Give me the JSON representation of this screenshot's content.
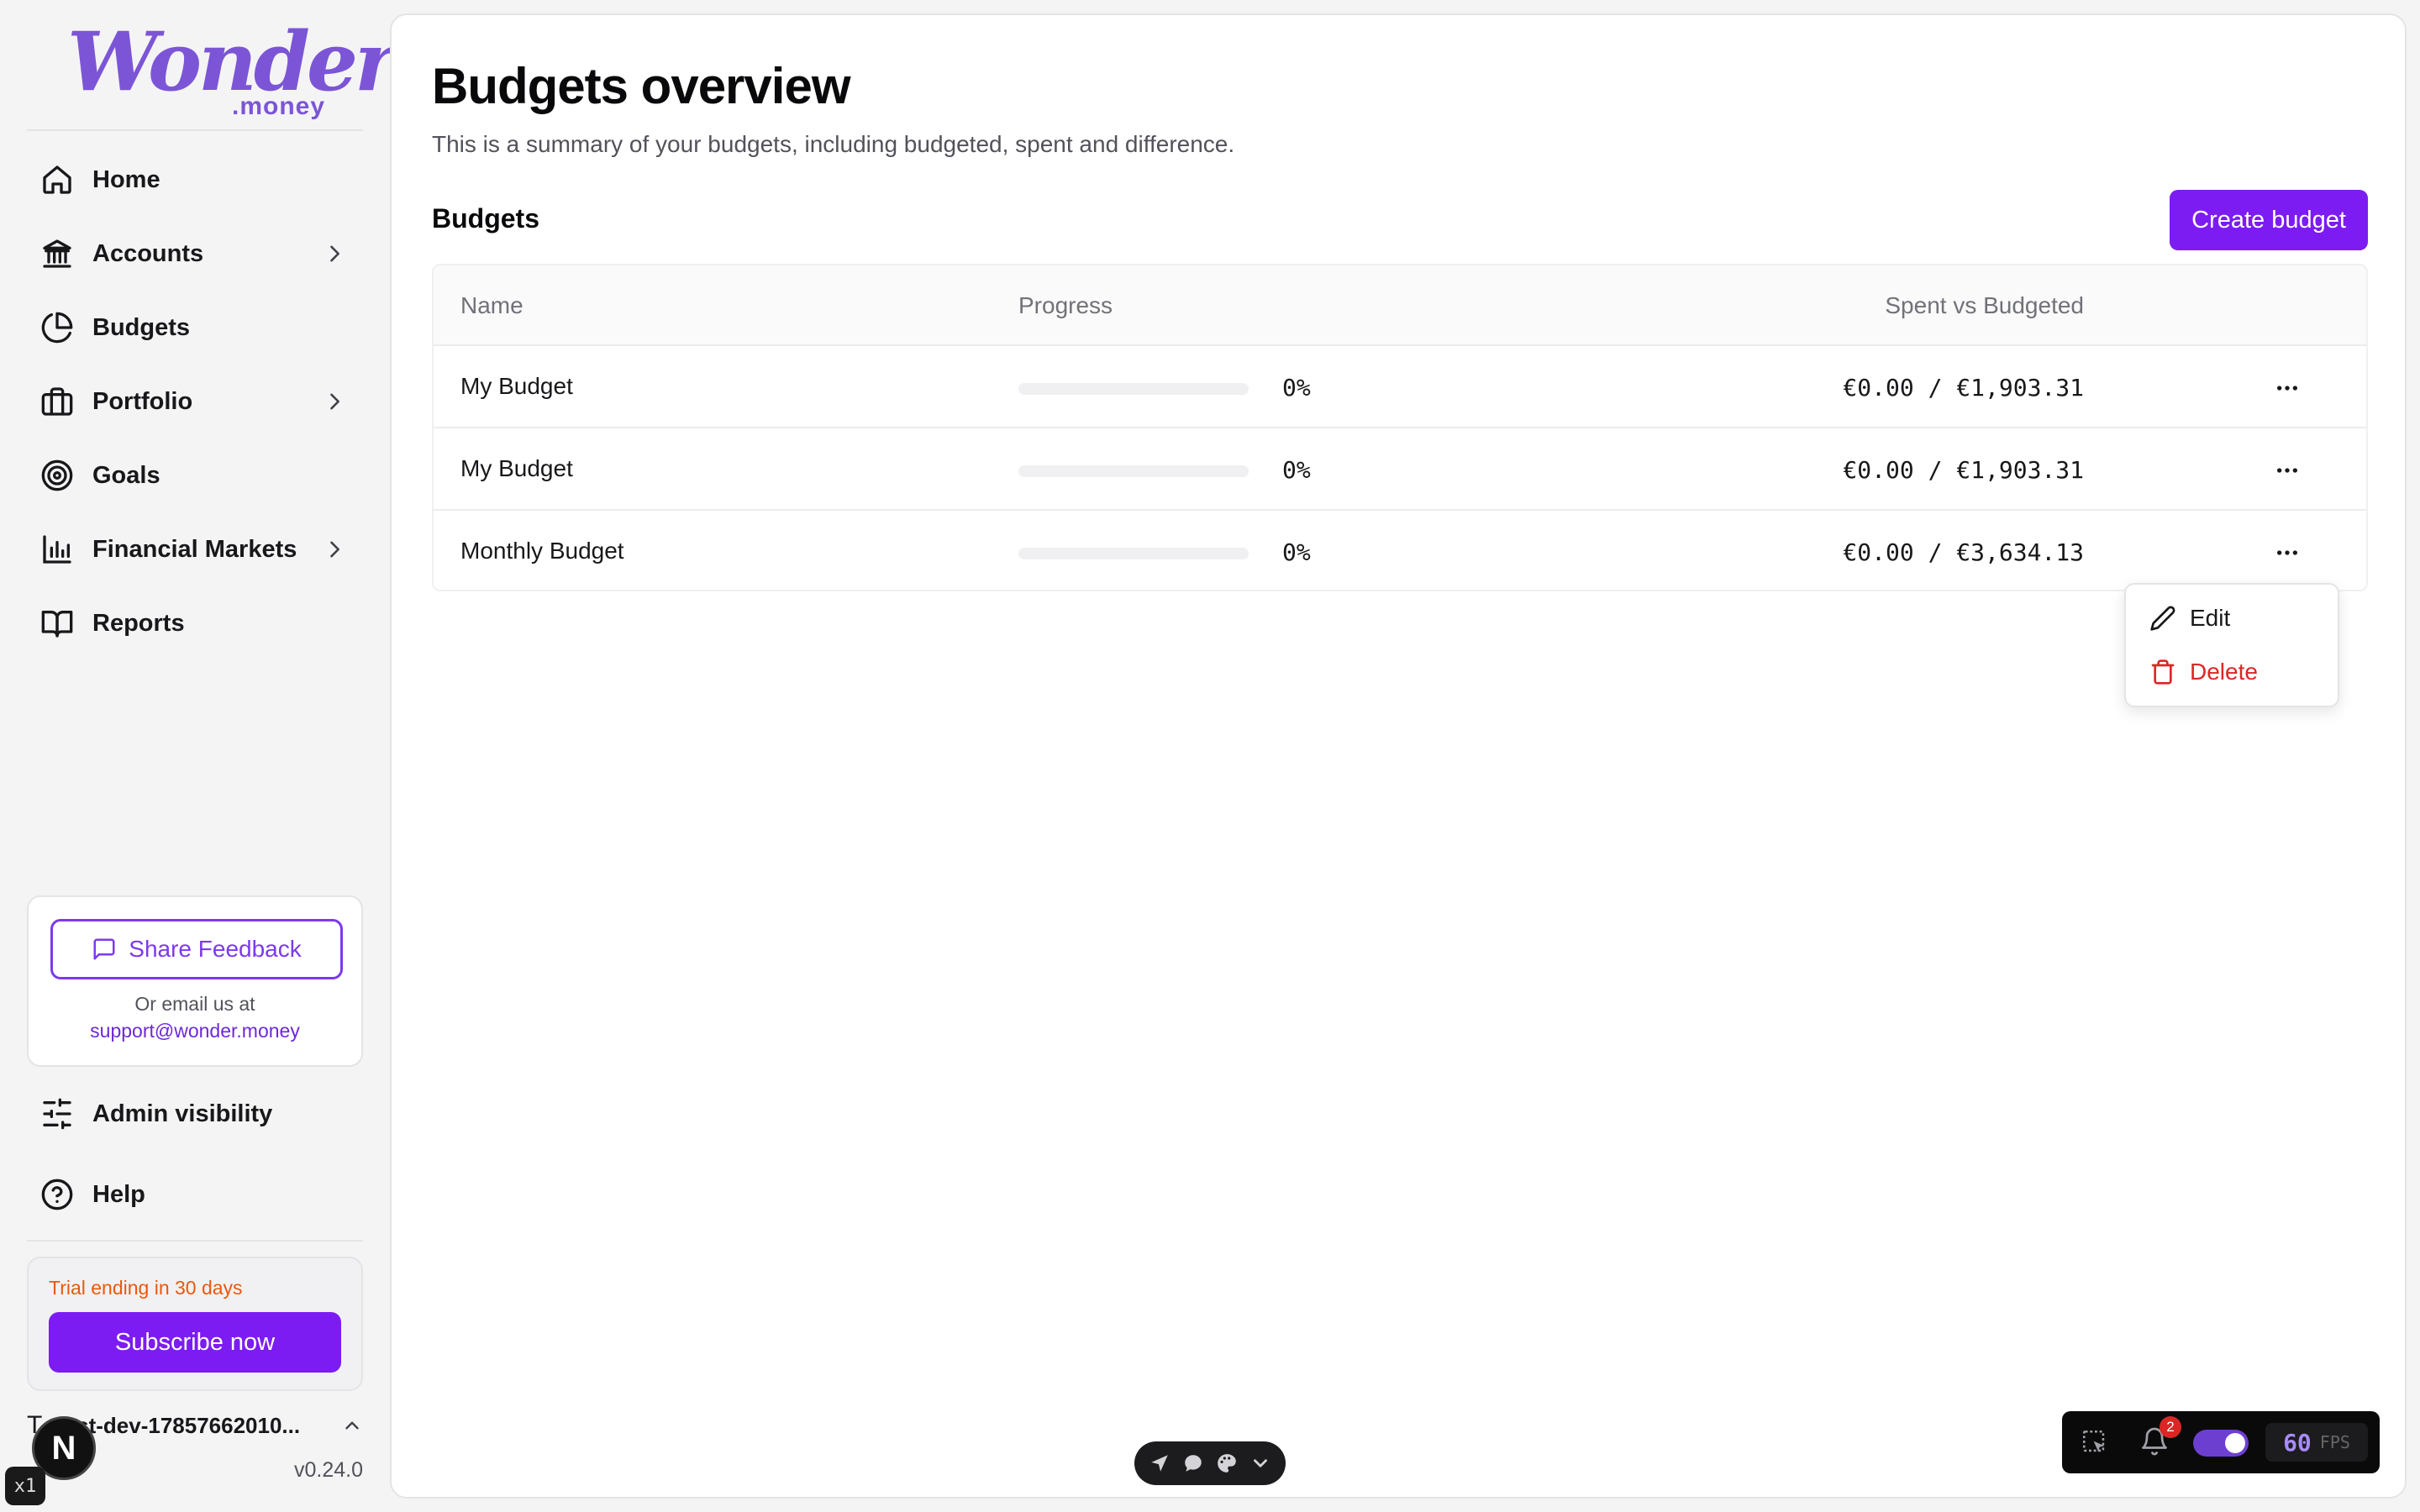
{
  "brand": {
    "name": "Wonder",
    "suffix": ".money",
    "color": "#7c55d6"
  },
  "sidebar": {
    "items": [
      {
        "label": "Home",
        "icon": "home-icon",
        "has_submenu": false
      },
      {
        "label": "Accounts",
        "icon": "bank-icon",
        "has_submenu": true
      },
      {
        "label": "Budgets",
        "icon": "pie-chart-icon",
        "has_submenu": false
      },
      {
        "label": "Portfolio",
        "icon": "briefcase-icon",
        "has_submenu": true
      },
      {
        "label": "Goals",
        "icon": "target-icon",
        "has_submenu": false
      },
      {
        "label": "Financial Markets",
        "icon": "bar-chart-icon",
        "has_submenu": true
      },
      {
        "label": "Reports",
        "icon": "book-icon",
        "has_submenu": false
      }
    ],
    "feedback": {
      "button_label": "Share Feedback",
      "note": "Or email us at",
      "email": "support@wonder.money"
    },
    "bottom_items": [
      {
        "label": "Admin visibility",
        "icon": "sliders-icon"
      },
      {
        "label": "Help",
        "icon": "help-circle-icon"
      }
    ],
    "trial": {
      "text": "Trial ending in 30 days",
      "button_label": "Subscribe now"
    },
    "user": {
      "initial": "T",
      "name": "test-dev-17857662010...",
      "version": "v0.24.0"
    }
  },
  "main": {
    "title": "Budgets overview",
    "subtitle": "This is a summary of your budgets, including budgeted, spent and difference.",
    "section_title": "Budgets",
    "create_button": "Create budget",
    "table": {
      "columns": [
        "Name",
        "Progress",
        "Spent vs Budgeted"
      ],
      "rows": [
        {
          "name": "My Budget",
          "progress": 0,
          "percent": "0%",
          "amount": "€0.00 / €1,903.31"
        },
        {
          "name": "My Budget",
          "progress": 0,
          "percent": "0%",
          "amount": "€0.00 / €1,903.31"
        },
        {
          "name": "Monthly Budget",
          "progress": 0,
          "percent": "0%",
          "amount": "€0.00 / €3,634.13"
        }
      ]
    },
    "row_menu": {
      "edit": "Edit",
      "delete": "Delete"
    }
  },
  "devtools": {
    "next_badge": "N",
    "zoom": "x1",
    "notifications": "2",
    "fps_value": "60",
    "fps_label": "FPS"
  },
  "colors": {
    "accent": "#7c1cf2",
    "danger": "#dc2626",
    "trial": "#ea580c"
  }
}
